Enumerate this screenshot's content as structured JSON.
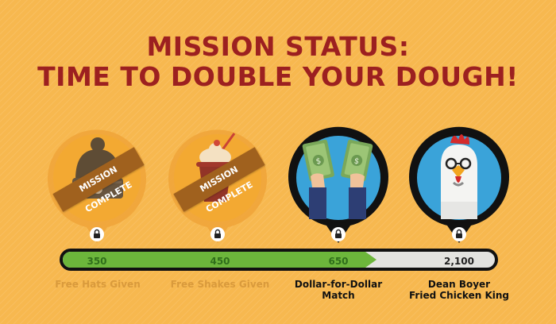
{
  "title": {
    "line1": "MISSION STATUS:",
    "line2": "TIME TO DOUBLE YOUR DOUGH!"
  },
  "colors": {
    "background": "#f7b84f",
    "title": "#9c2020",
    "progress_fill": "#6cb63b",
    "progress_empty": "#e3e3e0",
    "ribbon": "#a0611e"
  },
  "milestones": [
    {
      "icon": "beanie-hat-icon",
      "badge": "MISSION COMPLETE",
      "value": "350",
      "label_line1": "Free Hats Given",
      "status": "complete"
    },
    {
      "icon": "milkshake-icon",
      "badge": "MISSION COMPLETE",
      "value": "450",
      "label_line1": "Free Shakes Given",
      "status": "complete"
    },
    {
      "icon": "cash-in-hands-icon",
      "value": "650",
      "label_line1": "Dollar-for-Dollar",
      "label_line2": "Match",
      "status": "locked"
    },
    {
      "icon": "chicken-king-icon",
      "value": "2,100",
      "label_line1": "Dean Boyer",
      "label_line2": "Fried Chicken King",
      "status": "locked"
    }
  ],
  "progress": {
    "fill_fraction": 0.7
  }
}
